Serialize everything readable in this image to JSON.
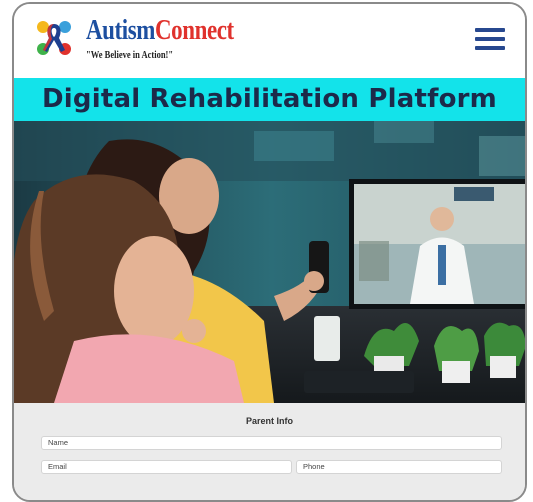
{
  "header": {
    "logo_icon": "autism-ribbon-puzzle-icon",
    "brand_part1": "Autism",
    "brand_part2": "Connect",
    "tagline": "\"We Believe in Action!\"",
    "menu_icon": "hamburger-menu-icon",
    "brand_color_primary": "#1d4fa0",
    "brand_color_accent": "#e0322d"
  },
  "banner": {
    "title": "Digital Rehabilitation Platform",
    "background": "#13e3ea"
  },
  "hero": {
    "image": "photo of a mother and daughter on a video call with a doctor"
  },
  "form": {
    "title": "Parent Info",
    "name_placeholder": "Name",
    "email_placeholder": "Email",
    "phone_placeholder": "Phone"
  }
}
